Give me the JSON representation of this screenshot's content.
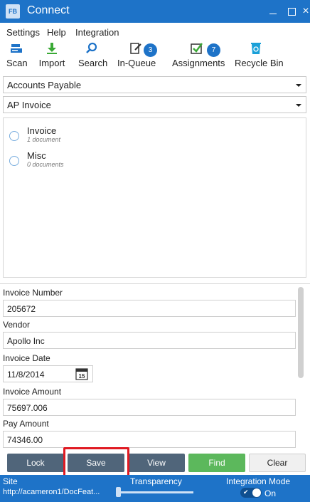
{
  "window": {
    "logo": "FB",
    "title": "Connect",
    "close_glyph": "×"
  },
  "menu": {
    "settings": "Settings",
    "help": "Help",
    "integration": "Integration"
  },
  "toolbar": {
    "scan": "Scan",
    "import": "Import",
    "search": "Search",
    "inqueue": "In-Queue",
    "inqueue_count": "3",
    "assignments": "Assignments",
    "assignments_count": "7",
    "recycle": "Recycle Bin"
  },
  "filters": {
    "department": "Accounts Payable",
    "doc_type": "AP Invoice"
  },
  "documents": [
    {
      "name": "Invoice",
      "count": "1 document"
    },
    {
      "name": "Misc",
      "count": "0 documents"
    }
  ],
  "fields": {
    "invoice_number": {
      "label": "Invoice Number",
      "value": "205672"
    },
    "vendor": {
      "label": "Vendor",
      "value": "Apollo Inc"
    },
    "invoice_date": {
      "label": "Invoice Date",
      "value": "11/8/2014",
      "calendar_day": "15"
    },
    "invoice_amount": {
      "label": "Invoice Amount",
      "value": "75697.006"
    },
    "pay_amount": {
      "label": "Pay Amount",
      "value": "74346.00"
    }
  },
  "actions": {
    "lock": "Lock",
    "save": "Save",
    "view": "View",
    "find": "Find",
    "clear": "Clear"
  },
  "status": {
    "site_label": "Site",
    "site_url": "http://acameron1/DocFeat...",
    "transparency_label": "Transparency",
    "transparency_level": 0,
    "integration_label": "Integration Mode",
    "integration_state": "On"
  },
  "colors": {
    "accent": "#1e73c8",
    "button_dark": "#50657a",
    "button_find": "#5cb85c",
    "highlight": "#e01a22"
  }
}
